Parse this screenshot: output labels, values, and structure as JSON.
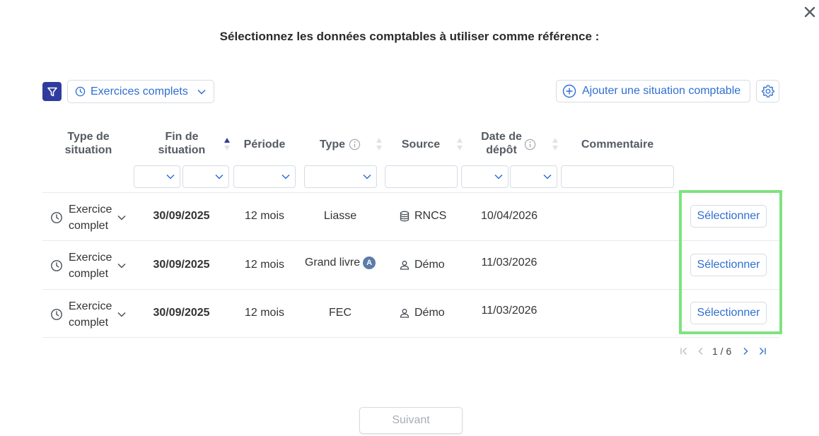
{
  "dialog": {
    "title": "Sélectionnez les données comptables à utiliser comme référence :",
    "close_icon": "close-icon"
  },
  "toolbar": {
    "filter_icon": "filter-funnel-icon",
    "period_select": "Exercices complets",
    "add_button": "Ajouter une situation comptable",
    "settings_icon": "gear-icon",
    "accent_color": "#2f3c9e",
    "link_color": "#2e6fd1"
  },
  "table": {
    "headers": {
      "type_situation": [
        "Type de",
        "situation"
      ],
      "fin_situation": [
        "Fin de",
        "situation"
      ],
      "periode": "Période",
      "type": "Type",
      "source": "Source",
      "date_depot": [
        "Date de",
        "dépôt"
      ],
      "commentaire": "Commentaire"
    },
    "rows": [
      {
        "situation": [
          "Exercice",
          "complet"
        ],
        "fin": "30/09/2025",
        "periode": "12 mois",
        "type": "Liasse",
        "type_badge": "",
        "source": "RNCS",
        "source_icon": "database-icon",
        "date_depot": "10/04/2026",
        "commentaire": "",
        "action": "Sélectionner"
      },
      {
        "situation": [
          "Exercice",
          "complet"
        ],
        "fin": "30/09/2025",
        "periode": "12 mois",
        "type": "Grand livre",
        "type_badge": "A",
        "source": "Démo",
        "source_icon": "user-icon",
        "date_depot": "11/03/2026",
        "commentaire": "",
        "action": "Sélectionner"
      },
      {
        "situation": [
          "Exercice",
          "complet"
        ],
        "fin": "30/09/2025",
        "periode": "12 mois",
        "type": "FEC",
        "type_badge": "",
        "source": "Démo",
        "source_icon": "user-icon",
        "date_depot": "11/03/2026",
        "commentaire": "",
        "action": "Sélectionner"
      }
    ]
  },
  "pagination": {
    "current": "1 / 6"
  },
  "footer": {
    "next_button": "Suivant"
  }
}
